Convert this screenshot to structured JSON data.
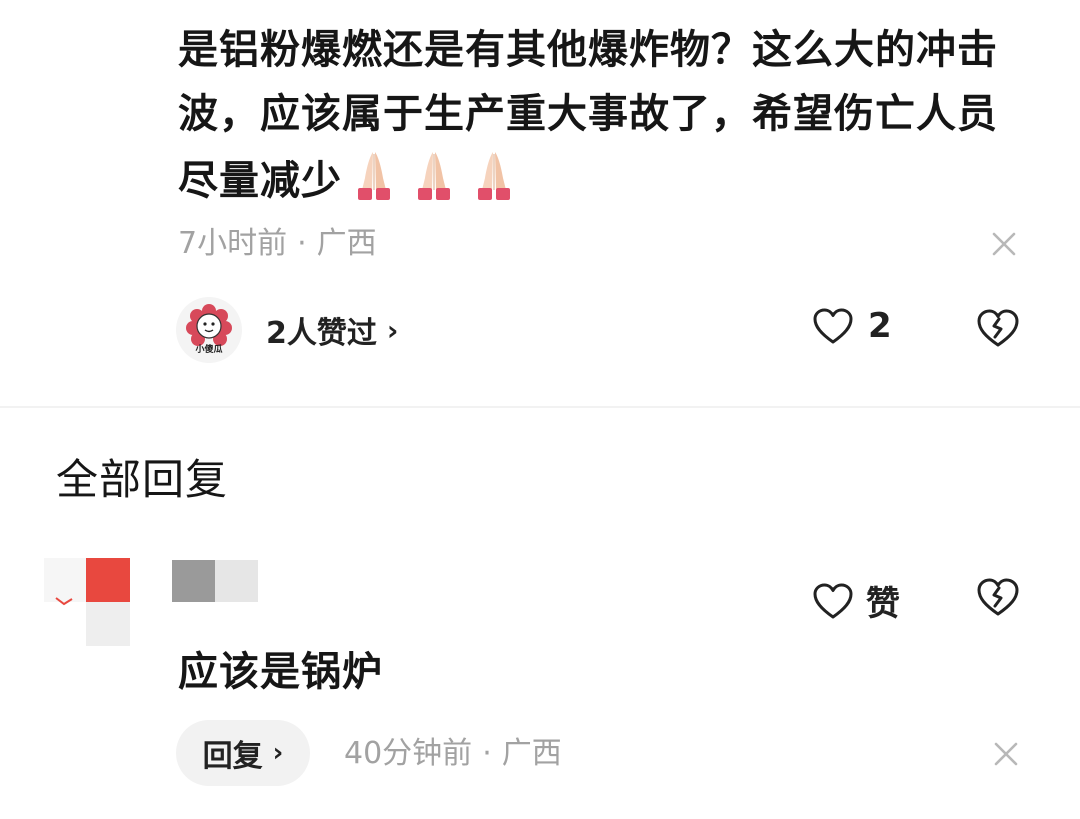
{
  "main_comment": {
    "text": "是铝粉爆燃还是有其他爆炸物？这么大的冲击波，应该属于生产重大事故了，希望伤亡人员尽量减少",
    "emoji_count": 3,
    "time": "7小时前",
    "separator": "·",
    "location": "广西",
    "likers_text": "2人赞过",
    "likers_chevron": "›",
    "liker_avatar_label": "小傻瓜",
    "like_count": "2"
  },
  "replies_section": {
    "title": "全部回复"
  },
  "reply": {
    "text": "应该是锅炉",
    "like_label": "赞",
    "reply_button_label": "回复",
    "reply_button_chevron": "›",
    "time": "40分钟前",
    "separator": "·",
    "location": "广西"
  },
  "colors": {
    "text_primary": "#161616",
    "text_secondary": "#a2a2a2",
    "divider": "#f2f2f2",
    "button_bg": "#f2f2f2",
    "avatar_red": "#e8483f"
  }
}
